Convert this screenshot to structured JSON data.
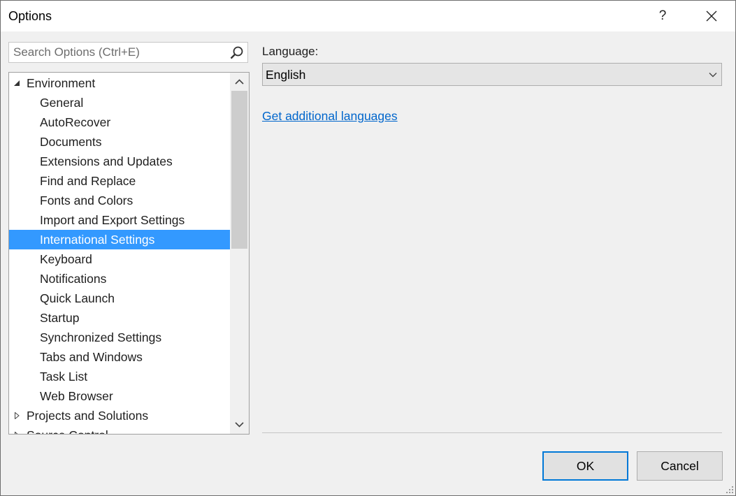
{
  "window": {
    "title": "Options",
    "help_label": "?"
  },
  "search": {
    "placeholder": "Search Options (Ctrl+E)"
  },
  "tree": {
    "items": [
      {
        "label": "Environment",
        "level": 0,
        "expander": "expanded"
      },
      {
        "label": "General",
        "level": 1
      },
      {
        "label": "AutoRecover",
        "level": 1
      },
      {
        "label": "Documents",
        "level": 1
      },
      {
        "label": "Extensions and Updates",
        "level": 1
      },
      {
        "label": "Find and Replace",
        "level": 1
      },
      {
        "label": "Fonts and Colors",
        "level": 1
      },
      {
        "label": "Import and Export Settings",
        "level": 1
      },
      {
        "label": "International Settings",
        "level": 1,
        "selected": true
      },
      {
        "label": "Keyboard",
        "level": 1
      },
      {
        "label": "Notifications",
        "level": 1
      },
      {
        "label": "Quick Launch",
        "level": 1
      },
      {
        "label": "Startup",
        "level": 1
      },
      {
        "label": "Synchronized Settings",
        "level": 1
      },
      {
        "label": "Tabs and Windows",
        "level": 1
      },
      {
        "label": "Task List",
        "level": 1
      },
      {
        "label": "Web Browser",
        "level": 1
      },
      {
        "label": "Projects and Solutions",
        "level": 0,
        "expander": "collapsed"
      },
      {
        "label": "Source Control",
        "level": 0,
        "expander": "collapsed"
      }
    ]
  },
  "language": {
    "label": "Language:",
    "selected": "English",
    "link": "Get additional languages"
  },
  "buttons": {
    "ok": "OK",
    "cancel": "Cancel"
  },
  "colors": {
    "selection": "#3399ff",
    "link": "#0066cc",
    "default_button_border": "#0078d7"
  }
}
